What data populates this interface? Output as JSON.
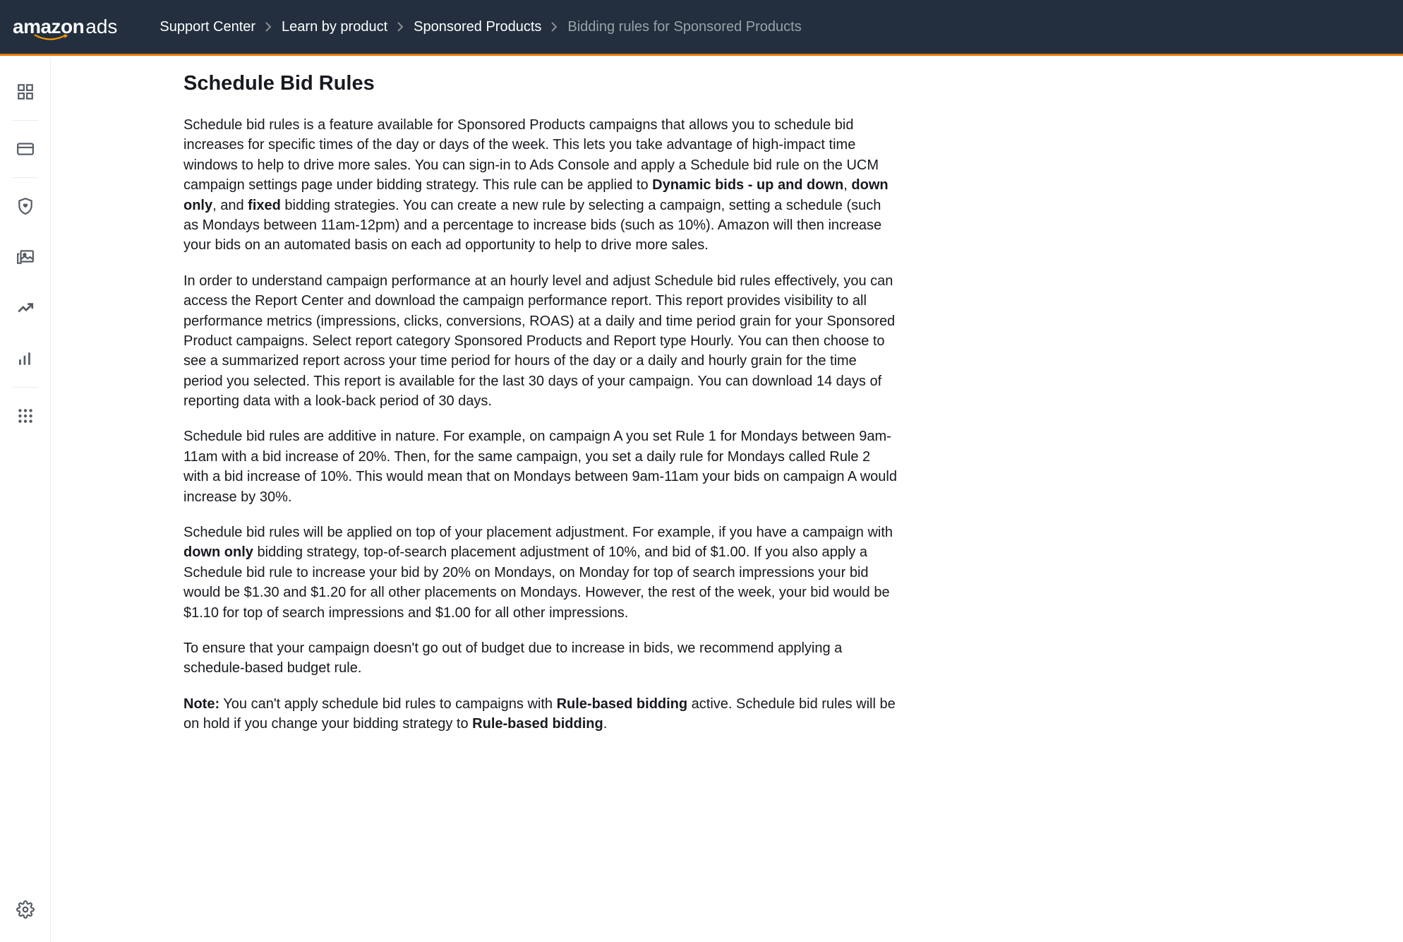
{
  "logo": {
    "brand": "amazon",
    "suffix": "ads"
  },
  "breadcrumb": [
    {
      "label": "Support Center",
      "current": false
    },
    {
      "label": "Learn by product",
      "current": false
    },
    {
      "label": "Sponsored Products",
      "current": false
    },
    {
      "label": "Bidding rules for Sponsored Products",
      "current": true
    }
  ],
  "article": {
    "title": "Schedule Bid Rules",
    "p1_a": "Schedule bid rules is a feature available for Sponsored Products campaigns that allows you to schedule bid increases for specific times of the day or days of the week. This lets you take advantage of high-impact time windows to help to drive more sales. You can sign-in to Ads Console and apply a Schedule bid rule on the UCM campaign settings page under bidding strategy. This rule can be applied to ",
    "p1_bold1": "Dynamic bids - up and down",
    "p1_b": ", ",
    "p1_bold2": "down only",
    "p1_c": ", and ",
    "p1_bold3": "fixed",
    "p1_d": " bidding strategies. You can create a new rule by selecting a campaign, setting a schedule (such as Mondays between 11am-12pm) and a percentage to increase bids (such as 10%). Amazon will then increase your bids on an automated basis on each ad opportunity to help to drive more sales.",
    "p2": "In order to understand campaign performance at an hourly level and adjust Schedule bid rules effectively, you can access the Report Center and download the campaign performance report. This report provides visibility to all performance metrics (impressions, clicks, conversions, ROAS) at a daily and time period grain for your Sponsored Product campaigns. Select report category Sponsored Products and Report type Hourly. You can then choose to see a summarized report across your time period for hours of the day or a daily and hourly grain for the time period you selected. This report is available for the last 30 days of your campaign. You can download 14 days of reporting data with a look-back period of 30 days.",
    "p3": "Schedule bid rules are additive in nature. For example, on campaign A you set Rule 1 for Mondays between 9am-11am with a bid increase of 20%. Then, for the same campaign, you set a daily rule for Mondays called Rule 2 with a bid increase of 10%. This would mean that on Mondays between 9am-11am your bids on campaign A would increase by 30%.",
    "p4_a": "Schedule bid rules will be applied on top of your placement adjustment. For example, if you have a campaign with ",
    "p4_bold1": "down only",
    "p4_b": " bidding strategy, top-of-search placement adjustment of 10%, and bid of $1.00. If you also apply a Schedule bid rule to increase your bid by 20% on Mondays, on Monday for top of search impressions your bid would be $1.30 and $1.20 for all other placements on Mondays. However, the rest of the week, your bid would be $1.10 for top of search impressions and $1.00 for all other impressions.",
    "p5": "To ensure that your campaign doesn't go out of budget due to increase in bids, we recommend applying a schedule-based budget rule.",
    "p6_bold1": "Note:",
    "p6_a": " You can't apply schedule bid rules to campaigns with ",
    "p6_bold2": "Rule-based bidding",
    "p6_b": " active. Schedule bid rules will be on hold if you change your bidding strategy to ",
    "p6_bold3": "Rule-based bidding",
    "p6_c": "."
  }
}
